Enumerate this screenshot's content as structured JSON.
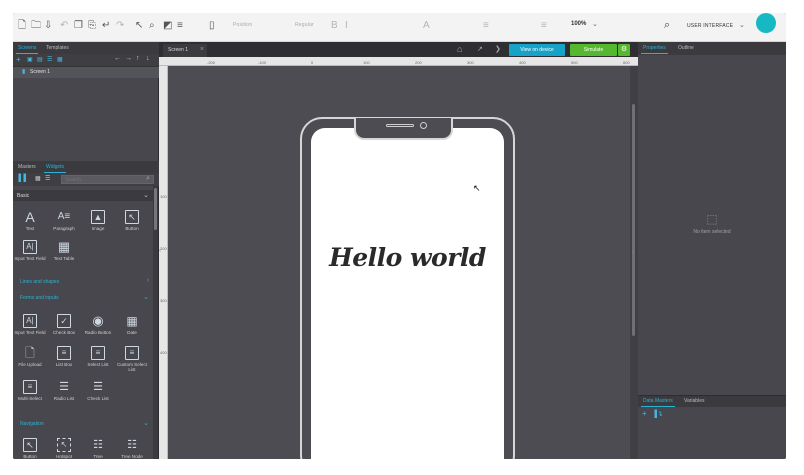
{
  "toolbar": {
    "position_label": "Position",
    "regular_label": "Regular",
    "zoom": "100%",
    "ui_label": "USER INTERFACE",
    "icons": [
      "new-file-icon",
      "open-folder-icon",
      "save-icon",
      "undo-icon",
      "redo-icon",
      "copy-icon",
      "paste-icon",
      "cut-icon",
      "pointer-icon",
      "zoom-tool-icon",
      "eraser-icon",
      "stack-icon",
      "device-icon",
      "bold-icon",
      "italic-icon",
      "align-icon",
      "search-icon"
    ]
  },
  "left_panel": {
    "screens_tabs": [
      "Screens",
      "Templates"
    ],
    "screen_items": [
      "Screen 1"
    ],
    "widget_tabs": [
      "Masters",
      "Widgets"
    ],
    "search_placeholder": "Search...",
    "sections": {
      "basic": "Basic",
      "lines_and_shapes": "Lines and shapes",
      "forms_and_inputs": "Forms and inputs",
      "navigation": "Navigation"
    },
    "basic_widgets": [
      {
        "label": "Text",
        "icon": "text-icon"
      },
      {
        "label": "Paragraph",
        "icon": "paragraph-icon"
      },
      {
        "label": "Image",
        "icon": "image-icon"
      },
      {
        "label": "Button",
        "icon": "button-icon"
      },
      {
        "label": "Input Text Field",
        "icon": "input-text-field-icon"
      },
      {
        "label": "Text Table",
        "icon": "text-table-icon"
      }
    ],
    "form_widgets": [
      {
        "label": "Input Text Field",
        "icon": "input-text-field-icon"
      },
      {
        "label": "Check Box",
        "icon": "check-box-icon"
      },
      {
        "label": "Radio Button",
        "icon": "radio-button-icon"
      },
      {
        "label": "Date",
        "icon": "date-icon"
      },
      {
        "label": "File Upload",
        "icon": "file-upload-icon"
      },
      {
        "label": "List Box",
        "icon": "list-box-icon"
      },
      {
        "label": "Select List",
        "icon": "select-list-icon"
      },
      {
        "label": "Custom Select List",
        "icon": "custom-select-list-icon"
      },
      {
        "label": "Multi-Select",
        "icon": "multi-select-icon"
      },
      {
        "label": "Radio List",
        "icon": "radio-list-icon"
      },
      {
        "label": "Check List",
        "icon": "check-list-icon"
      }
    ],
    "nav_widgets": [
      {
        "label": "Button",
        "icon": "nav-button-icon"
      },
      {
        "label": "Hotspot",
        "icon": "hotspot-icon"
      },
      {
        "label": "Tree",
        "icon": "tree-icon"
      },
      {
        "label": "Tree Node",
        "icon": "tree-node-icon"
      }
    ]
  },
  "canvas": {
    "tab_label": "Screen 1",
    "view_on_device": "View on device",
    "simulate": "Simulate",
    "ruler_top": [
      "-200",
      "-100",
      "0",
      "100",
      "200",
      "300",
      "400",
      "500",
      "600"
    ],
    "ruler_left": [
      "100",
      "200",
      "300",
      "400"
    ],
    "hello_text": "Hello world"
  },
  "right_panel": {
    "tabs": [
      "Properties",
      "Outline"
    ],
    "empty_text": "No item selected",
    "bottom_tabs": [
      "Data Masters",
      "Variables"
    ]
  },
  "colors": {
    "accent": "#2ab3d6",
    "view_button": "#16a3c7",
    "simulate_button": "#55b82e",
    "avatar": "#16b9c3"
  }
}
